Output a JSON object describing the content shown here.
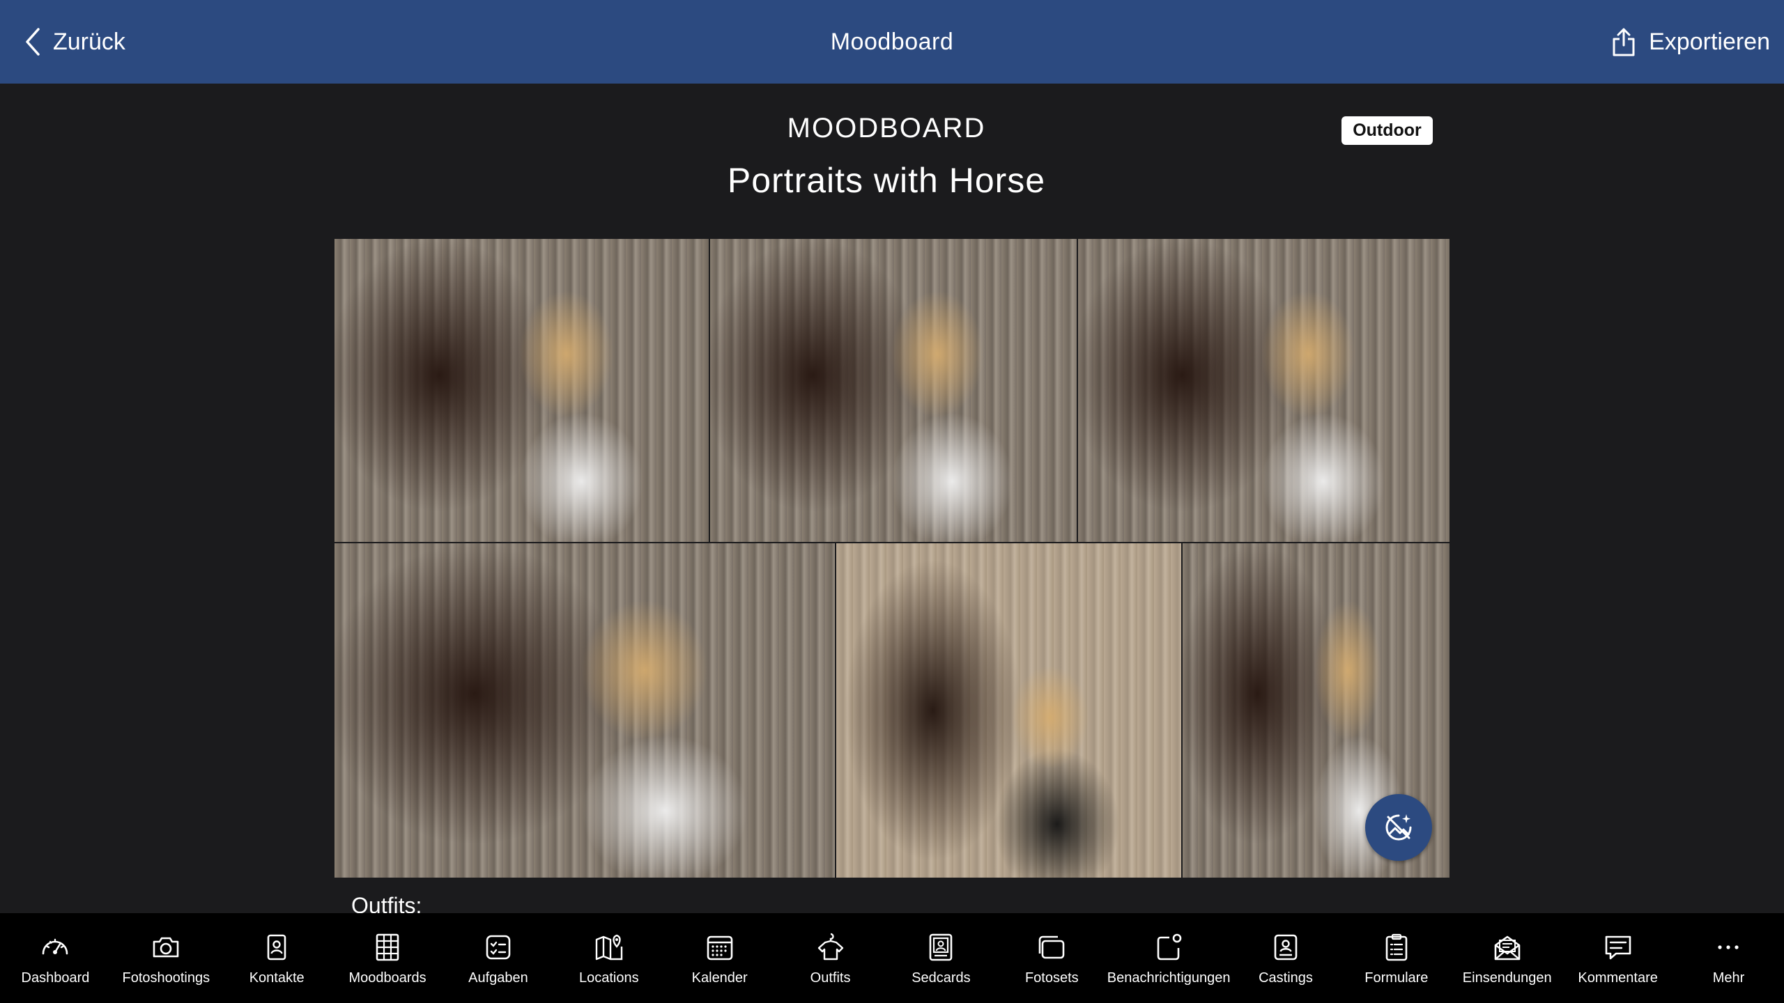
{
  "nav": {
    "back_label": "Zurück",
    "title": "Moodboard",
    "export_label": "Exportieren"
  },
  "header": {
    "label": "MOODBOARD",
    "title": "Portraits with Horse",
    "tag": "Outdoor"
  },
  "section": {
    "outfits_label": "Outfits:"
  },
  "colors": {
    "nav_bg": "#2c4a80",
    "page_bg": "#1b1b1d",
    "tabbar_bg": "#000000"
  },
  "tabs": [
    {
      "label": "Dashboard",
      "icon": "speedometer-icon"
    },
    {
      "label": "Fotoshootings",
      "icon": "camera-icon"
    },
    {
      "label": "Kontakte",
      "icon": "contact-card-icon"
    },
    {
      "label": "Moodboards",
      "icon": "grid-board-icon"
    },
    {
      "label": "Aufgaben",
      "icon": "checklist-icon"
    },
    {
      "label": "Locations",
      "icon": "map-pin-icon"
    },
    {
      "label": "Kalender",
      "icon": "calendar-icon"
    },
    {
      "label": "Outfits",
      "icon": "hanger-icon"
    },
    {
      "label": "Sedcards",
      "icon": "sedcard-icon"
    },
    {
      "label": "Fotosets",
      "icon": "photo-stack-icon"
    },
    {
      "label": "Benachrichtigungen",
      "icon": "notification-icon"
    },
    {
      "label": "Castings",
      "icon": "casting-icon"
    },
    {
      "label": "Formulare",
      "icon": "clipboard-icon"
    },
    {
      "label": "Einsendungen",
      "icon": "envelope-icon"
    },
    {
      "label": "Kommentare",
      "icon": "comment-icon"
    },
    {
      "label": "Mehr",
      "icon": "more-dots-icon"
    }
  ]
}
